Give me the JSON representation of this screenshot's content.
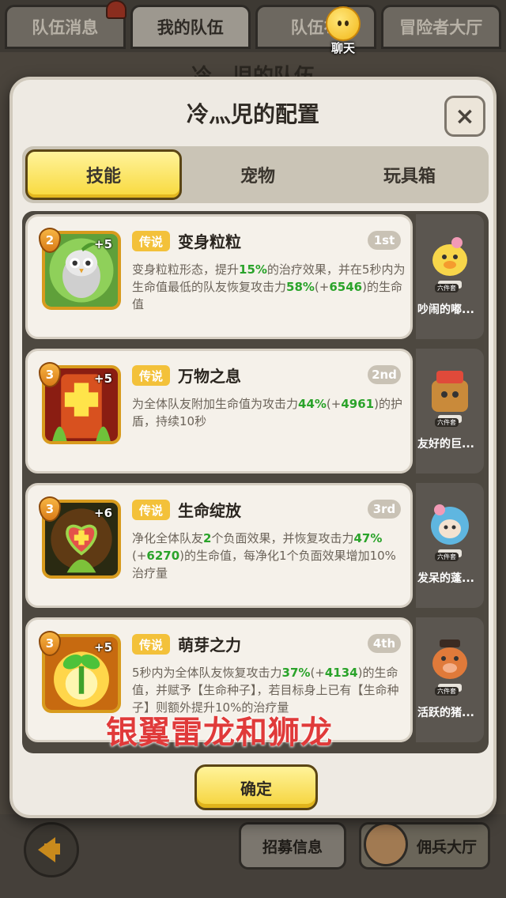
{
  "background": {
    "tabs": [
      "队伍消息",
      "我的队伍",
      "队伍布",
      "冒险者大厅"
    ],
    "chat_label": "聊天",
    "team_title": "冷灬児的队伍",
    "recruit_label": "招募信息",
    "mercenary_label": "佣兵大厅"
  },
  "dialog": {
    "title": "冷灬児的配置",
    "close_label": "×",
    "tabs": [
      "技能",
      "宠物",
      "玩具箱"
    ],
    "confirm_label": "确定"
  },
  "skills": [
    {
      "level": "2",
      "plus": "+5",
      "rarity": "传说",
      "name": "变身粒粒",
      "order": "1st",
      "desc": [
        "变身粒粒形态，提升",
        "15%",
        "的治疗效果，并在5秒内为生命值最低的队友恢复攻击力",
        "58%",
        "(+",
        "6546",
        ")的生命值"
      ]
    },
    {
      "level": "3",
      "plus": "+5",
      "rarity": "传说",
      "name": "万物之息",
      "order": "2nd",
      "desc": [
        "为全体队友附加生命值为攻击力",
        "44%",
        "(+",
        "4961",
        ")的护盾，持续10秒"
      ]
    },
    {
      "level": "3",
      "plus": "+6",
      "rarity": "传说",
      "name": "生命绽放",
      "order": "3rd",
      "desc": [
        "净化全体队友",
        "2",
        "个负面效果，并恢复攻击力",
        "47%",
        "(+",
        "6270",
        ")的生命值，每净化1个负面效果增加10%治疗量"
      ]
    },
    {
      "level": "3",
      "plus": "+5",
      "rarity": "传说",
      "name": "萌芽之力",
      "order": "4th",
      "desc": [
        "5秒内为全体队友恢复攻击力",
        "37%",
        "(+",
        "4134",
        ")的生命值，并赋予【生命种子】，若目标身上已有【生命种子】则额外提升10%的治疗量"
      ]
    }
  ],
  "pets": [
    {
      "name": "吵闹的嘟...",
      "tag": "六件套"
    },
    {
      "name": "友好的巨...",
      "tag": "六件套"
    },
    {
      "name": "发呆的蓬...",
      "tag": "六件套"
    },
    {
      "name": "活跃的猪...",
      "tag": "六件套"
    }
  ],
  "watermark": "银翼雷龙和狮龙",
  "colors": {
    "accent_yellow": "#f8d93c",
    "green_value": "#2aa32a",
    "rarity_gold": "#f3c13a"
  }
}
